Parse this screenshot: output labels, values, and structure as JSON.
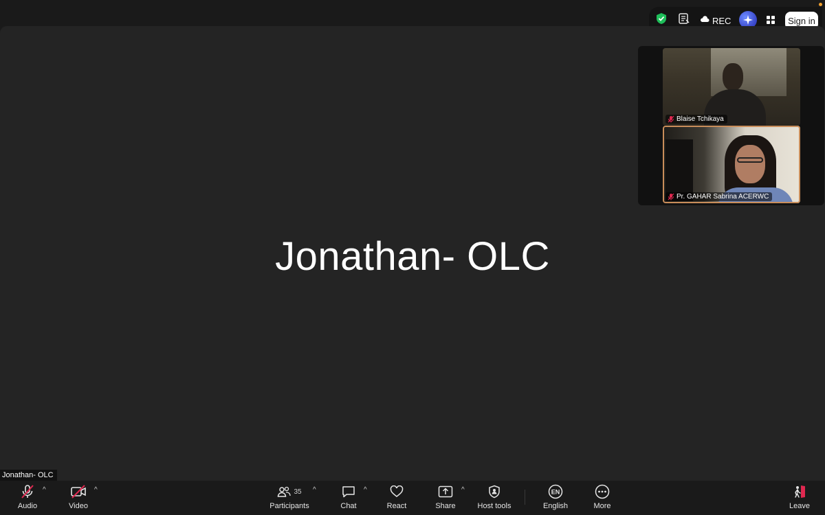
{
  "top_bar": {
    "rec_label": "REC",
    "sign_in_label": "Sign in",
    "icons": [
      "shield-check-icon",
      "notes-icon",
      "cloud-icon",
      "ai-companion-icon",
      "apps-icon"
    ]
  },
  "main_view": {
    "speaker_name": "Jonathan- OLC",
    "name_tag": "Jonathan- OLC"
  },
  "gallery": {
    "tiles": [
      {
        "name": "Blaise Tchikaya",
        "muted": true
      },
      {
        "name": "Pr. GAHAR Sabrina ACERWC",
        "muted": true,
        "active": true
      }
    ]
  },
  "toolbar": {
    "audio": {
      "label": "Audio",
      "muted": true
    },
    "video": {
      "label": "Video",
      "off": true
    },
    "participants": {
      "label": "Participants",
      "count": "35"
    },
    "chat": {
      "label": "Chat"
    },
    "react": {
      "label": "React"
    },
    "share": {
      "label": "Share"
    },
    "host_tools": {
      "label": "Host tools"
    },
    "language": {
      "label": "English",
      "badge": "EN"
    },
    "more": {
      "label": "More"
    },
    "leave": {
      "label": "Leave"
    }
  },
  "colors": {
    "background": "#1a1a1a",
    "stage": "#242424",
    "muted_red": "#e02850",
    "shield_green": "#1fbf5a",
    "active_border": "#c98d5a"
  }
}
